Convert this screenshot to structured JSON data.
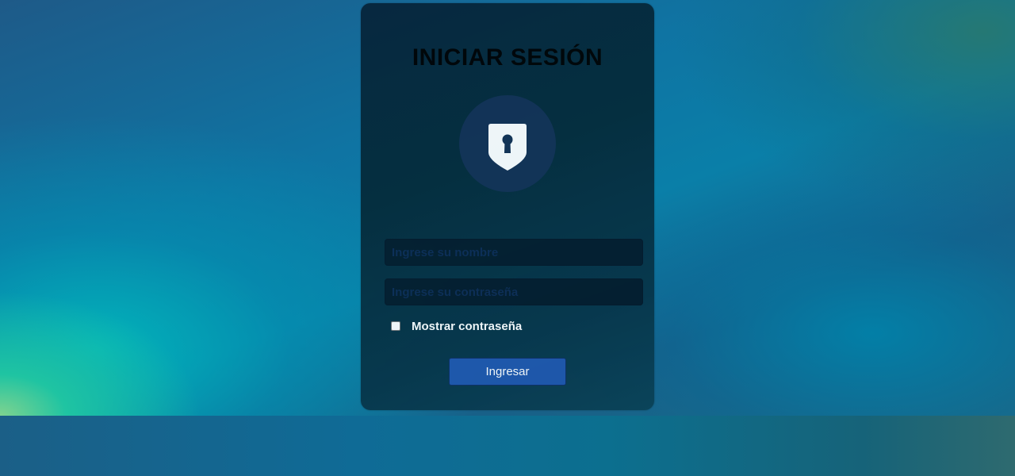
{
  "login": {
    "title": "INICIAR SESIÓN",
    "icon": "shield-keyhole-icon",
    "username_placeholder": "Ingrese su nombre",
    "password_placeholder": "Ingrese su contraseña",
    "username_value": "",
    "password_value": "",
    "show_password_label": "Mostrar contraseña",
    "show_password_checked": false,
    "submit_label": "Ingresar"
  },
  "colors": {
    "card_background": "#052a39",
    "icon_circle": "#132f52",
    "button_background": "#1f57ad",
    "title_text": "#000000"
  }
}
